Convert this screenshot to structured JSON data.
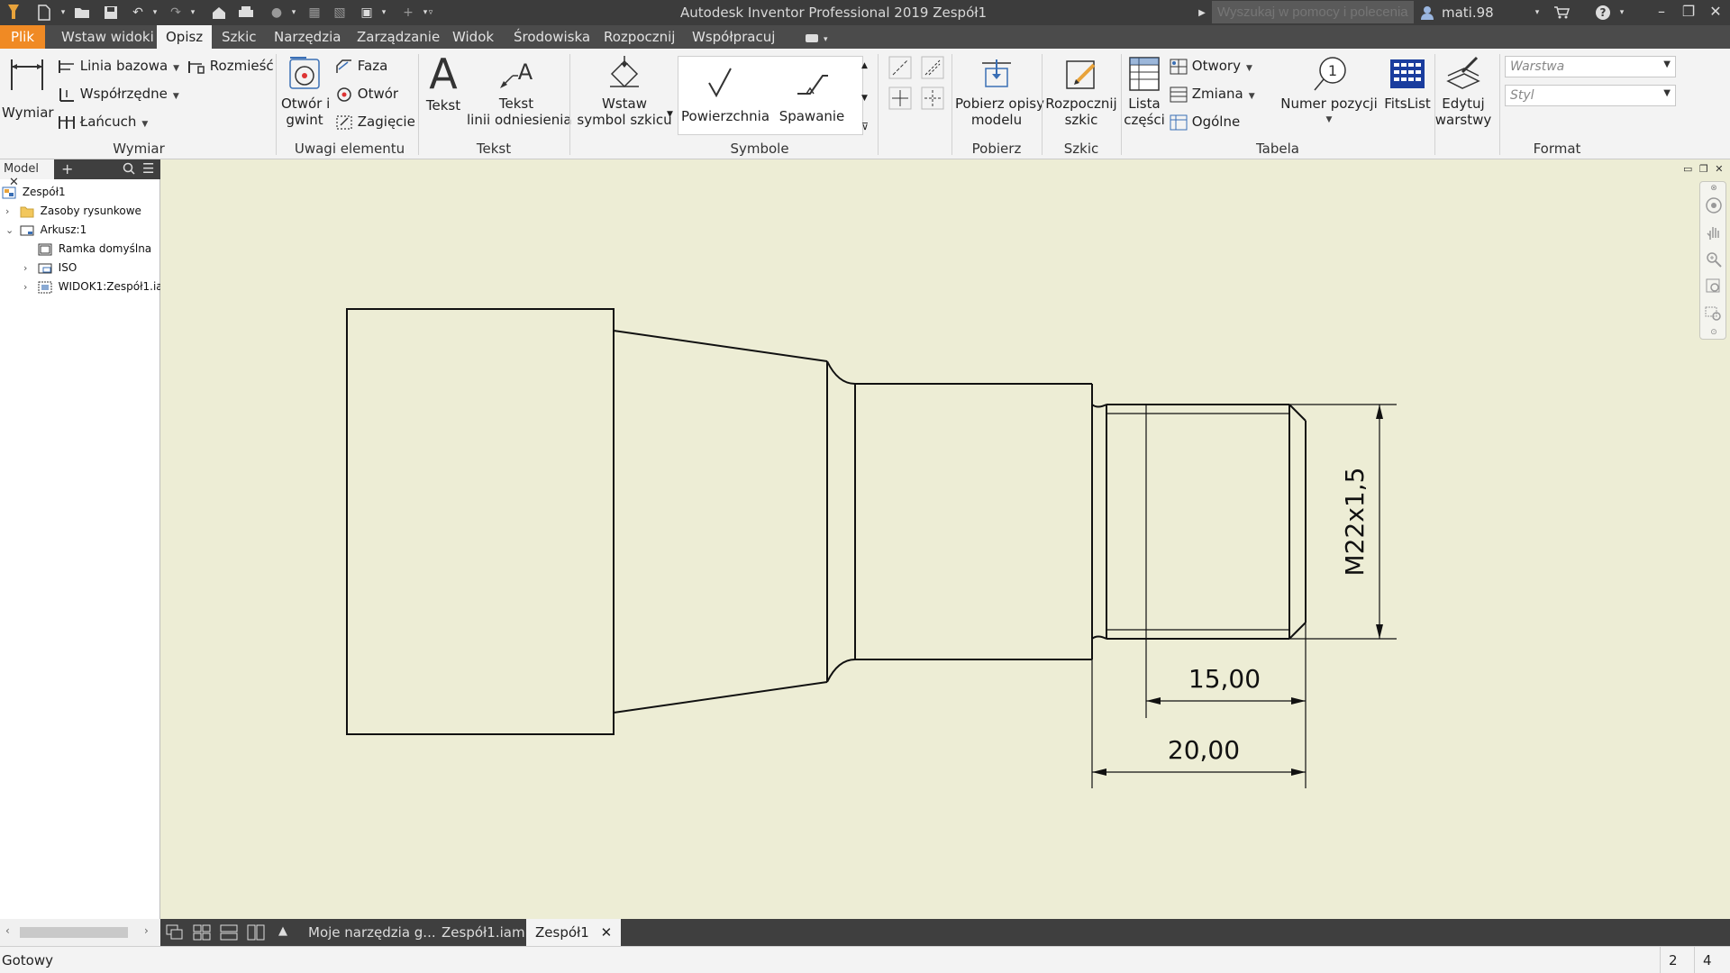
{
  "app": {
    "title": "Autodesk Inventor Professional 2019    Zespół1",
    "help_search_placeholder": "Wyszukaj w pomocy i polecenia",
    "user": "mati.98"
  },
  "menu_tabs": [
    "Plik",
    "Wstaw widoki",
    "Opisz",
    "Szkic",
    "Narzędzia",
    "Zarządzanie",
    "Widok",
    "Środowiska",
    "Rozpocznij",
    "Współpracuj"
  ],
  "ribbon": {
    "wymiar": {
      "big_button": "Wymiar",
      "items": [
        "Linia bazowa",
        "Współrzędne",
        "Łańcuch"
      ],
      "rozmiesc": "Rozmieść",
      "panel": "Wymiar"
    },
    "uwagi": {
      "otwor_gwint_line1": "Otwór i",
      "otwor_gwint_line2": "gwint",
      "items": [
        "Faza",
        "Otwór",
        "Zagięcie"
      ],
      "panel": "Uwagi elementu"
    },
    "tekst": {
      "tekst": "Tekst",
      "linia_line1": "Tekst",
      "linia_line2": "linii odniesienia",
      "panel": "Tekst"
    },
    "symbole": {
      "wstaw_line1": "Wstaw",
      "wstaw_line2": "symbol szkicu",
      "powierzchnia": "Powierzchnia",
      "spawanie": "Spawanie",
      "panel": "Symbole"
    },
    "pobierz": {
      "line1": "Pobierz opisy",
      "line2": "modelu",
      "panel": "Pobierz"
    },
    "szkic": {
      "line1": "Rozpocznij",
      "line2": "szkic",
      "panel": "Szkic"
    },
    "tabela": {
      "lista_line1": "Lista",
      "lista_line2": "części",
      "items": [
        "Otwory",
        "Zmiana",
        "Ogólne"
      ],
      "numer": "Numer pozycji",
      "fitslist": "FitsList",
      "edytuj_line1": "Edytuj",
      "edytuj_line2": "warstwy",
      "panel": "Tabela"
    },
    "format": {
      "warstwa": "Warstwa",
      "styl": "Styl",
      "panel": "Format"
    }
  },
  "browser": {
    "tab": "Model",
    "tree": [
      "Zespół1",
      "Zasoby rysunkowe",
      "Arkusz:1",
      "Ramka domyślna",
      "ISO",
      "WIDOK1:Zespół1.iam"
    ]
  },
  "drawing": {
    "dim_thread": "M22x1,5",
    "dim_15": "15,00",
    "dim_20": "20,00"
  },
  "doc_tabs": [
    "Moje narzędzia g...",
    "Zespół1.iam",
    "Zespół1"
  ],
  "status": {
    "text": "Gotowy",
    "num1": "2",
    "num2": "4"
  }
}
